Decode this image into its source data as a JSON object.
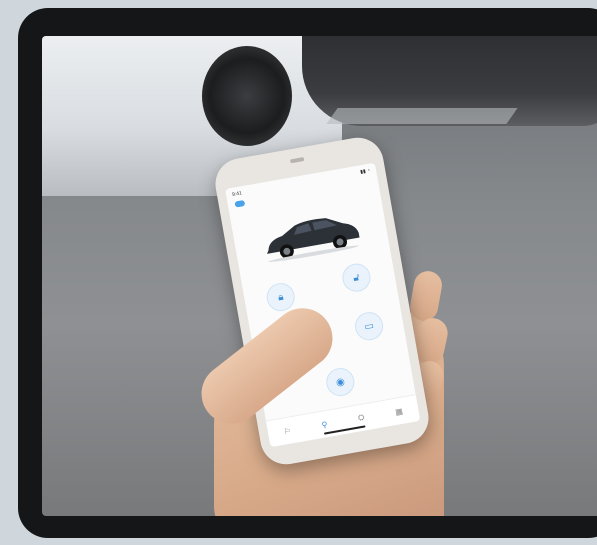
{
  "phone_app": {
    "status_time": "9:41",
    "status_icons": "▮▮ ◔",
    "header_title": "",
    "tab_icons": [
      "⚐",
      "⚲",
      "⛭",
      "▦"
    ],
    "buttons": [
      {
        "icon": "lock-icon",
        "glyph": "🔒︎",
        "label": ""
      },
      {
        "icon": "unlock-icon",
        "glyph": "🔓︎",
        "label": ""
      },
      {
        "icon": "climate-icon",
        "glyph": "❄",
        "label": ""
      },
      {
        "icon": "car-icon",
        "glyph": "▭",
        "label": ""
      },
      {
        "icon": "horn-icon",
        "glyph": "◉",
        "label": ""
      }
    ]
  },
  "colors": {
    "accent": "#3b8ed8",
    "bezel": "#141618",
    "car_body": "#2c3138"
  }
}
